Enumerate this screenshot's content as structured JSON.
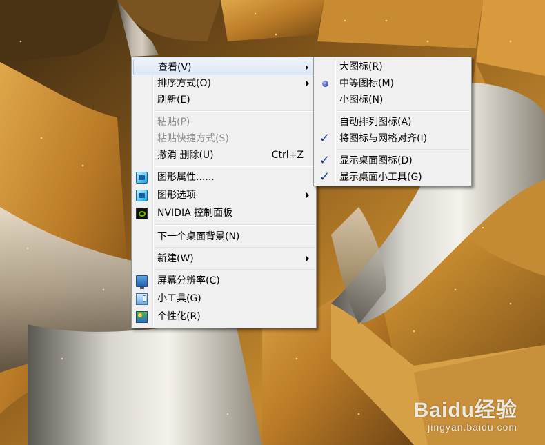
{
  "main_menu": {
    "items": [
      {
        "label": "查看(V)",
        "has_submenu": true,
        "highlighted": true
      },
      {
        "label": "排序方式(O)",
        "has_submenu": true
      },
      {
        "label": "刷新(E)"
      },
      {
        "label": "粘贴(P)",
        "disabled": true
      },
      {
        "label": "粘贴快捷方式(S)",
        "disabled": true
      },
      {
        "label": "撤消 删除(U)",
        "shortcut": "Ctrl+Z"
      },
      {
        "label": "图形属性......",
        "icon": "intel-graphics-icon"
      },
      {
        "label": "图形选项",
        "icon": "intel-graphics-icon",
        "has_submenu": true
      },
      {
        "label": "NVIDIA 控制面板",
        "icon": "nvidia-icon"
      },
      {
        "label": "下一个桌面背景(N)"
      },
      {
        "label": "新建(W)",
        "has_submenu": true
      },
      {
        "label": "屏幕分辨率(C)",
        "icon": "monitor-icon"
      },
      {
        "label": "小工具(G)",
        "icon": "gadgets-icon"
      },
      {
        "label": "个性化(R)",
        "icon": "personalize-icon"
      }
    ]
  },
  "view_submenu": {
    "items": [
      {
        "label": "大图标(R)"
      },
      {
        "label": "中等图标(M)",
        "selected": true
      },
      {
        "label": "小图标(N)"
      },
      {
        "label": "自动排列图标(A)"
      },
      {
        "label": "将图标与网格对齐(I)",
        "checked": true
      },
      {
        "label": "显示桌面图标(D)",
        "checked": true
      },
      {
        "label": "显示桌面小工具(G)",
        "checked": true
      }
    ]
  },
  "watermark": {
    "logo": "Baidu经验",
    "url": "jingyan.baidu.com"
  }
}
